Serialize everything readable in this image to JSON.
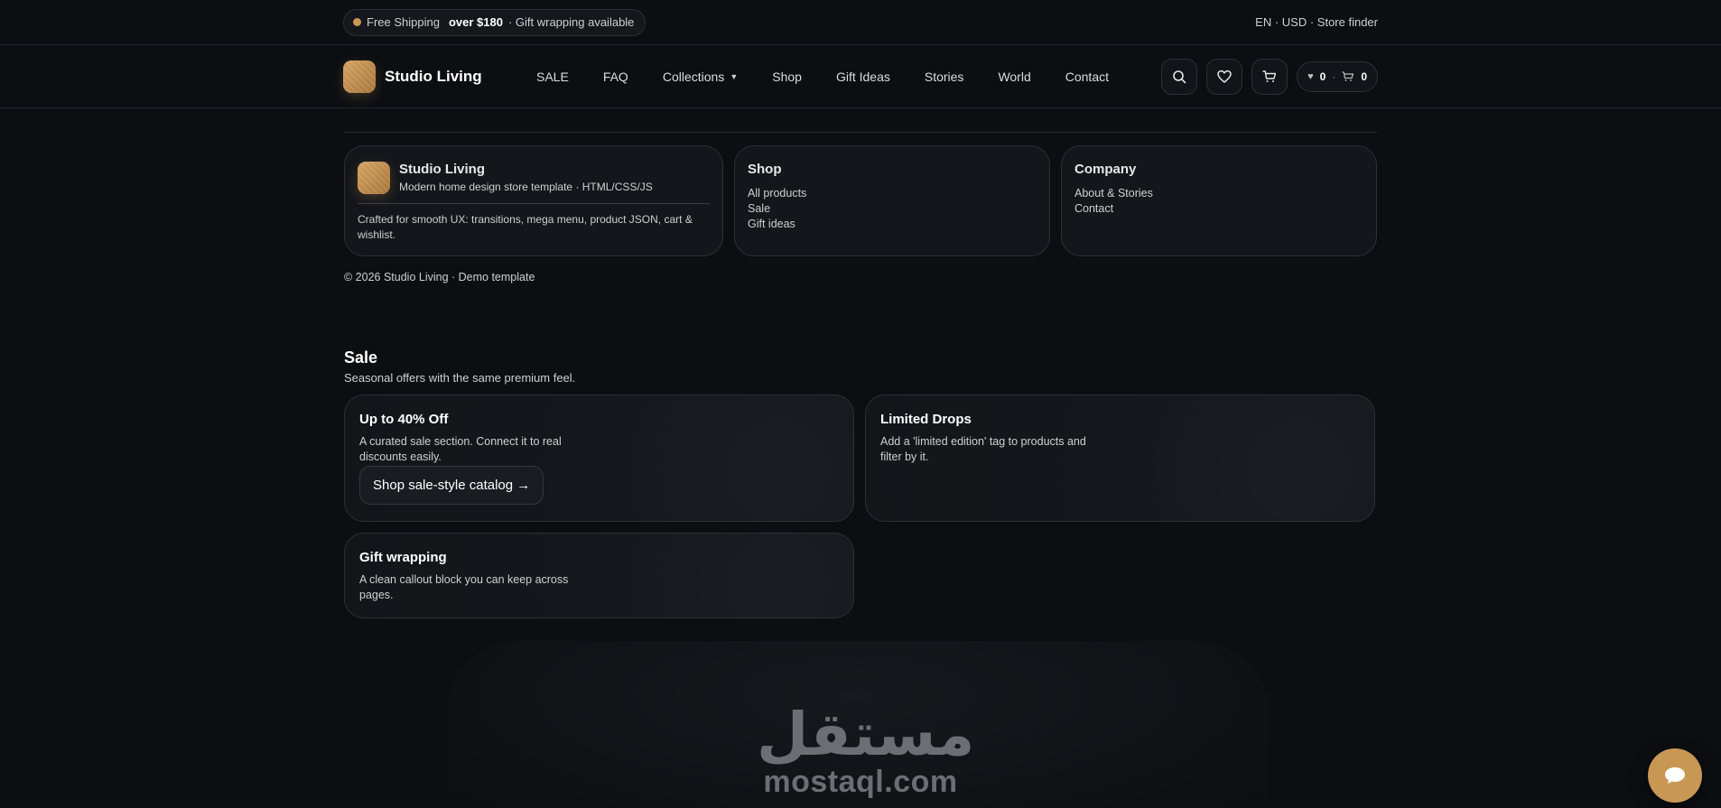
{
  "topbar": {
    "shipping_text": "Free Shipping",
    "shipping_threshold": "over $180",
    "gift_text": "· Gift wrapping available",
    "right_links": "EN · USD · Store finder"
  },
  "nav": {
    "brand": "Studio Living",
    "links": [
      "SALE",
      "FAQ",
      "Collections",
      "Shop",
      "Gift Ideas",
      "Stories",
      "World",
      "Contact"
    ],
    "counters": {
      "wishlist": "0",
      "cart": "0",
      "wishlist_symbol": "♥",
      "separator": "·"
    }
  },
  "footer": {
    "brand": {
      "name": "Studio Living",
      "subtitle": "Modern home design store template · HTML/CSS/JS",
      "description": "Crafted for smooth UX: transitions, mega menu, product JSON, cart & wishlist."
    },
    "shop": {
      "title": "Shop",
      "links": [
        "All products",
        "Sale",
        "Gift ideas"
      ]
    },
    "company": {
      "title": "Company",
      "links": [
        "About & Stories",
        "Contact"
      ]
    },
    "copyright": "© 2026 Studio Living · Demo template"
  },
  "sale": {
    "title": "Sale",
    "subtitle": "Seasonal offers with the same premium feel.",
    "cards": [
      {
        "title": "Up to 40% Off",
        "text": "A curated sale section. Connect it to real discounts easily.",
        "cta": "Shop sale-style catalog →"
      },
      {
        "title": "Limited Drops",
        "text": "Add a 'limited edition' tag to products and filter by it."
      },
      {
        "title": "Gift wrapping",
        "text": "A clean callout block you can keep across pages."
      }
    ]
  },
  "watermark": {
    "arabic": "مستقل",
    "latin": "mostaql.com"
  },
  "colors": {
    "accent": "#c99754",
    "background": "#0c0e12",
    "card": "#14161b",
    "border": "#2d3038"
  }
}
